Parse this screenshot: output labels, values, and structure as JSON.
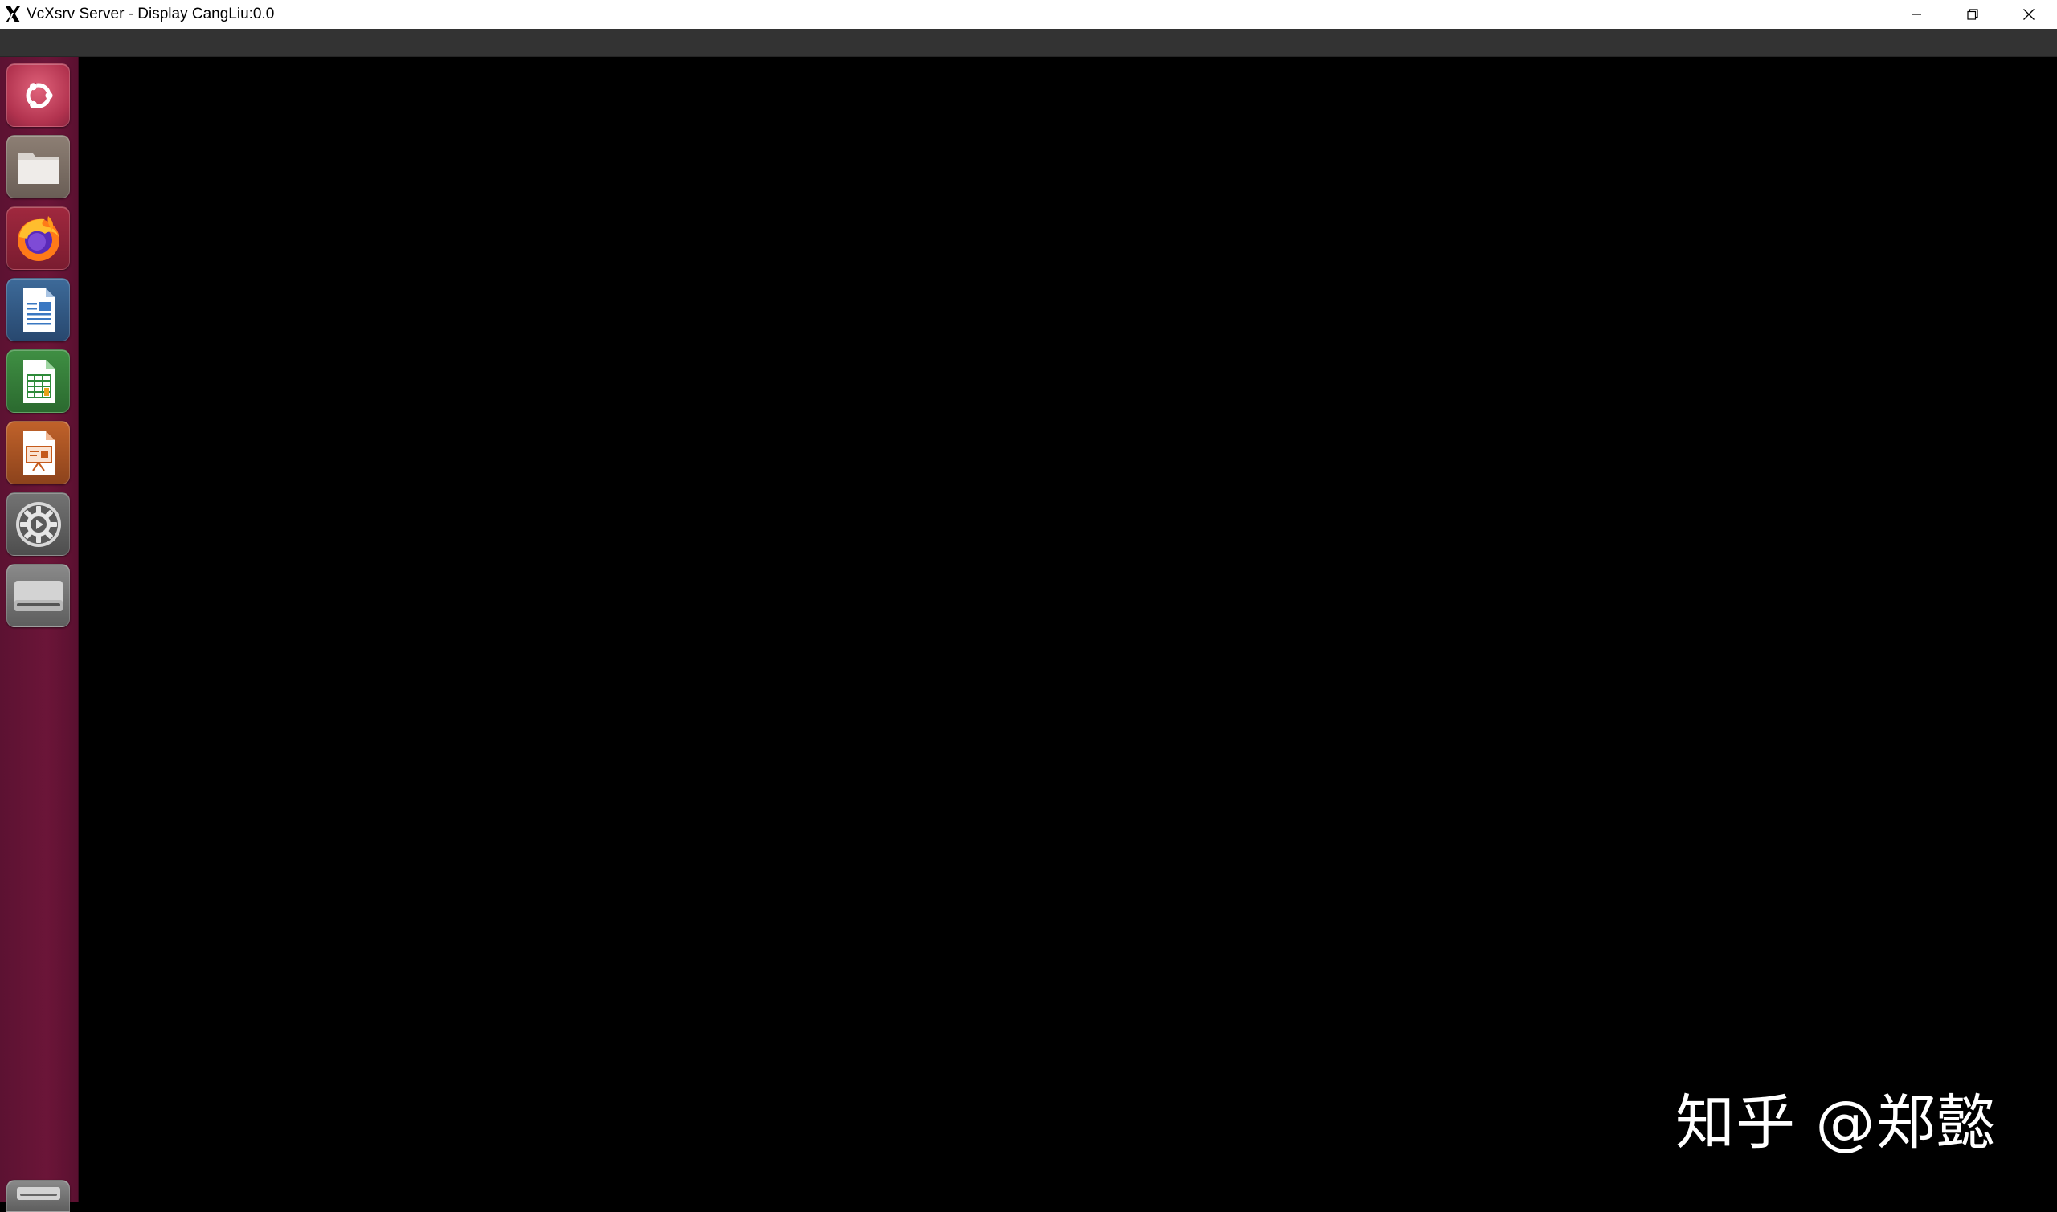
{
  "window": {
    "title": "VcXsrv Server - Display CangLiu:0.0"
  },
  "launcher": {
    "items": [
      {
        "name": "Dash Home",
        "icon": "ubuntu-logo-icon"
      },
      {
        "name": "Files",
        "icon": "folder-icon"
      },
      {
        "name": "Firefox",
        "icon": "firefox-icon"
      },
      {
        "name": "LibreOffice Writer",
        "icon": "writer-document-icon"
      },
      {
        "name": "LibreOffice Calc",
        "icon": "calc-spreadsheet-icon"
      },
      {
        "name": "LibreOffice Impress",
        "icon": "impress-presentation-icon"
      },
      {
        "name": "System Settings",
        "icon": "gear-icon"
      },
      {
        "name": "Drive",
        "icon": "drive-icon"
      },
      {
        "name": "Trash",
        "icon": "trash-icon"
      }
    ]
  },
  "watermark": {
    "text": "知乎 @郑懿"
  },
  "colors": {
    "launcher_bg": "#6b1538",
    "top_panel_bg": "#333333",
    "desktop_bg": "#000000",
    "titlebar_bg": "#ffffff"
  }
}
